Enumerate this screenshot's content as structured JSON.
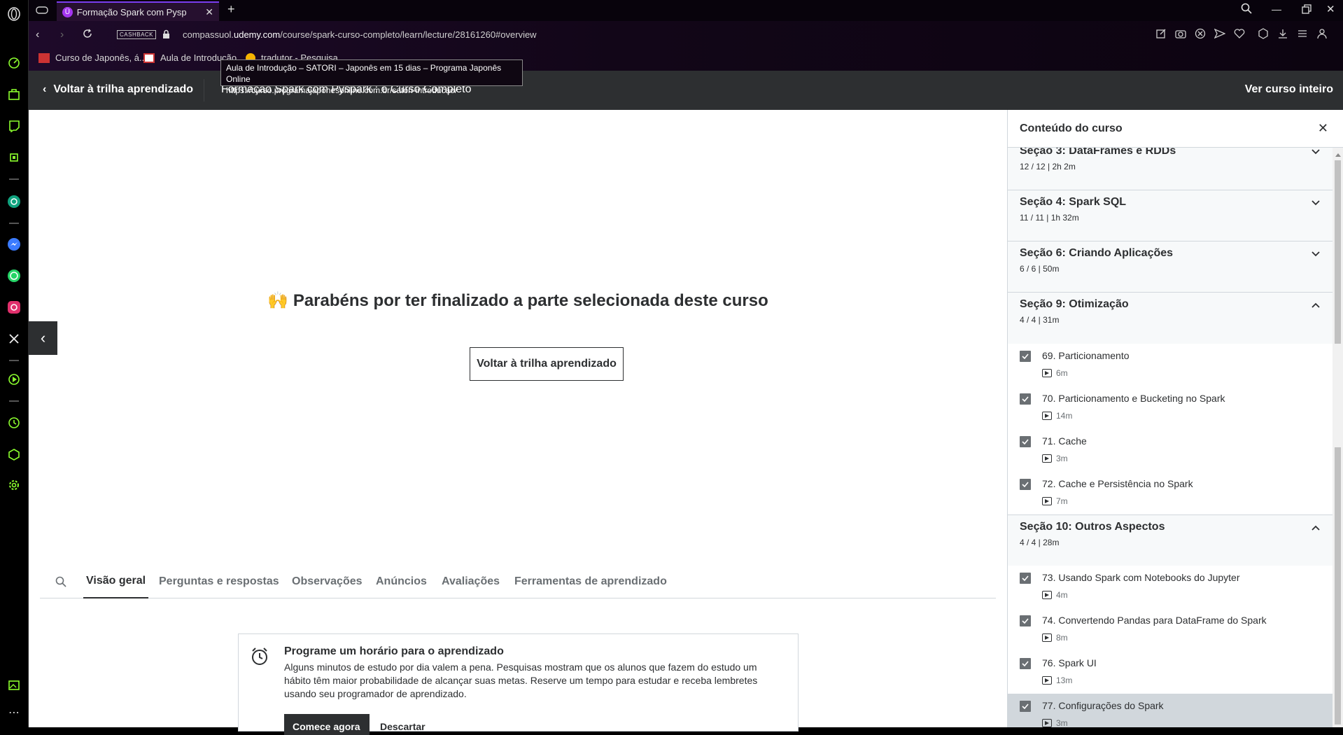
{
  "browser": {
    "tab_title": "Formação Spark com Pysp",
    "url_domain_prefix": "compassuol.",
    "url_domain": "udemy.com",
    "url_path": "/course/spark-curso-completo/learn/lecture/28161260#overview",
    "cashback_badge": "CASHBACK",
    "bookmarks": [
      "Curso de Japonês, á...",
      "Aula de Introdução",
      "tradutor - Pesquisa"
    ],
    "tooltip": {
      "title": "Aula de Introdução – SATORI – Japonês em 15 dias – Programa Japonês Online",
      "url": "https://curso.programajaponesonline.com.br/satori-introducao/"
    }
  },
  "header": {
    "back_label": "Voltar à trilha aprendizado",
    "course_title": "Formação Spark com Pyspark : o Curso Completo",
    "view_full_label": "Ver curso inteiro"
  },
  "main": {
    "congrats_emoji": "🙌",
    "congrats_text": "Parabéns por ter finalizado a parte selecionada deste curso",
    "back_button": "Voltar à trilha aprendizado",
    "tabs": [
      "Visão geral",
      "Perguntas e respostas",
      "Observações",
      "Anúncios",
      "Avaliações",
      "Ferramentas de aprendizado"
    ],
    "active_tab": "Visão geral",
    "schedule": {
      "title": "Programe um horário para o aprendizado",
      "body": "Alguns minutos de estudo por dia valem a pena. Pesquisas mostram que os alunos que fazem do estudo um hábito têm maior probabilidade de alcançar suas metas. Reserve um tempo para estudar e receba lembretes usando seu programador de aprendizado.",
      "primary_button": "Comece agora",
      "secondary_button": "Descartar"
    }
  },
  "sidebar_panel": {
    "title": "Conteúdo do curso",
    "sections": [
      {
        "title": "Seção 3: DataFrames e RDDs",
        "meta": "12 / 12 | 2h 2m",
        "expanded": false
      },
      {
        "title": "Seção 4: Spark SQL",
        "meta": "11 / 11 | 1h 32m",
        "expanded": false
      },
      {
        "title": "Seção 6: Criando Aplicações",
        "meta": "6 / 6 | 50m",
        "expanded": false
      },
      {
        "title": "Seção 9: Otimização",
        "meta": "4 / 4 | 31m",
        "expanded": true,
        "lectures": [
          {
            "title": "69. Particionamento",
            "duration": "6m"
          },
          {
            "title": "70. Particionamento e Bucketing no Spark",
            "duration": "14m"
          },
          {
            "title": "71. Cache",
            "duration": "3m"
          },
          {
            "title": "72. Cache e Persistência no Spark",
            "duration": "7m"
          }
        ]
      },
      {
        "title": "Seção 10: Outros Aspectos",
        "meta": "4 / 4 | 28m",
        "expanded": true,
        "lectures": [
          {
            "title": "73. Usando Spark com Notebooks do Jupyter",
            "duration": "4m"
          },
          {
            "title": "74. Convertendo Pandas para DataFrame do Spark",
            "duration": "8m"
          },
          {
            "title": "76. Spark UI",
            "duration": "13m"
          },
          {
            "title": "77. Configurações do Spark",
            "duration": "3m",
            "selected": true
          }
        ]
      }
    ]
  },
  "colors": {
    "accent": "#a435f0",
    "dark": "#2d2f31",
    "muted": "#6a6f73",
    "border": "#d1d7dc",
    "green_frame": "#8cff2e"
  }
}
